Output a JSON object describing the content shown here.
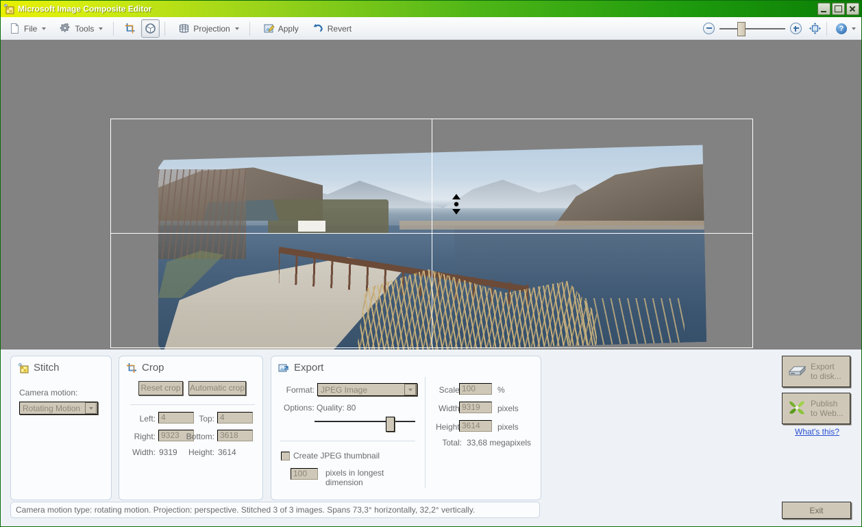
{
  "window": {
    "title": "Microsoft Image Composite Editor",
    "icon": "mosaic-icon",
    "minimize_label": "Minimize",
    "maximize_label": "Maximize",
    "close_label": "Close"
  },
  "toolbar": {
    "file_label": "File",
    "tools_label": "Tools",
    "crop_tool_label": "Crop tool",
    "orbit_tool_label": "3D orbit tool",
    "projection_label": "Projection",
    "apply_label": "Apply",
    "revert_label": "Revert",
    "zoom_out_label": "Zoom out",
    "zoom_in_label": "Zoom in",
    "fit_label": "Fit to window",
    "help_label": "Help"
  },
  "stitch": {
    "title": "Stitch",
    "camera_motion_label": "Camera motion:",
    "camera_motion_value": "Rotating Motion"
  },
  "crop": {
    "title": "Crop",
    "reset_label": "Reset crop",
    "automatic_label": "Automatic crop",
    "left_label": "Left:",
    "left_value": "4",
    "top_label": "Top:",
    "top_value": "4",
    "right_label": "Right:",
    "right_value": "9323",
    "bottom_label": "Bottom:",
    "bottom_value": "3618",
    "width_label": "Width:",
    "width_value": "9319",
    "height_label": "Height:",
    "height_value": "3614"
  },
  "export": {
    "title": "Export",
    "format_label": "Format:",
    "format_value": "JPEG Image",
    "options_label": "Options:",
    "quality_label": "Quality:",
    "quality_value": "80",
    "thumbnail_label": "Create JPEG thumbnail",
    "thumbnail_checked": false,
    "thumb_size_value": "100",
    "thumb_size_note_line1": "pixels in longest",
    "thumb_size_note_line2": "dimension",
    "scale_label": "Scale:",
    "scale_value": "100",
    "scale_unit": "%",
    "width_label": "Width:",
    "width_value": "9319",
    "width_unit": "pixels",
    "height_label": "Height:",
    "height_value": "3614",
    "height_unit": "pixels",
    "total_label": "Total:",
    "total_value": "33,68 megapixels"
  },
  "actions": {
    "export_disk_line1": "Export",
    "export_disk_line2": "to disk...",
    "publish_web_line1": "Publish",
    "publish_web_line2": "to Web...",
    "whats_this": "What's this?",
    "exit_label": "Exit"
  },
  "status": {
    "text": "Camera motion type: rotating motion. Projection: perspective. Stitched 3 of 3 images. Spans 73,3° horizontally, 32,2° vertically."
  },
  "colors": {
    "title_start": "#e8ef00",
    "title_end": "#0b7d06",
    "canvas_bg": "#828282",
    "panel_bg": "#fafcfe",
    "field_bg": "#cfc8b8",
    "link": "#2a4fd0"
  }
}
